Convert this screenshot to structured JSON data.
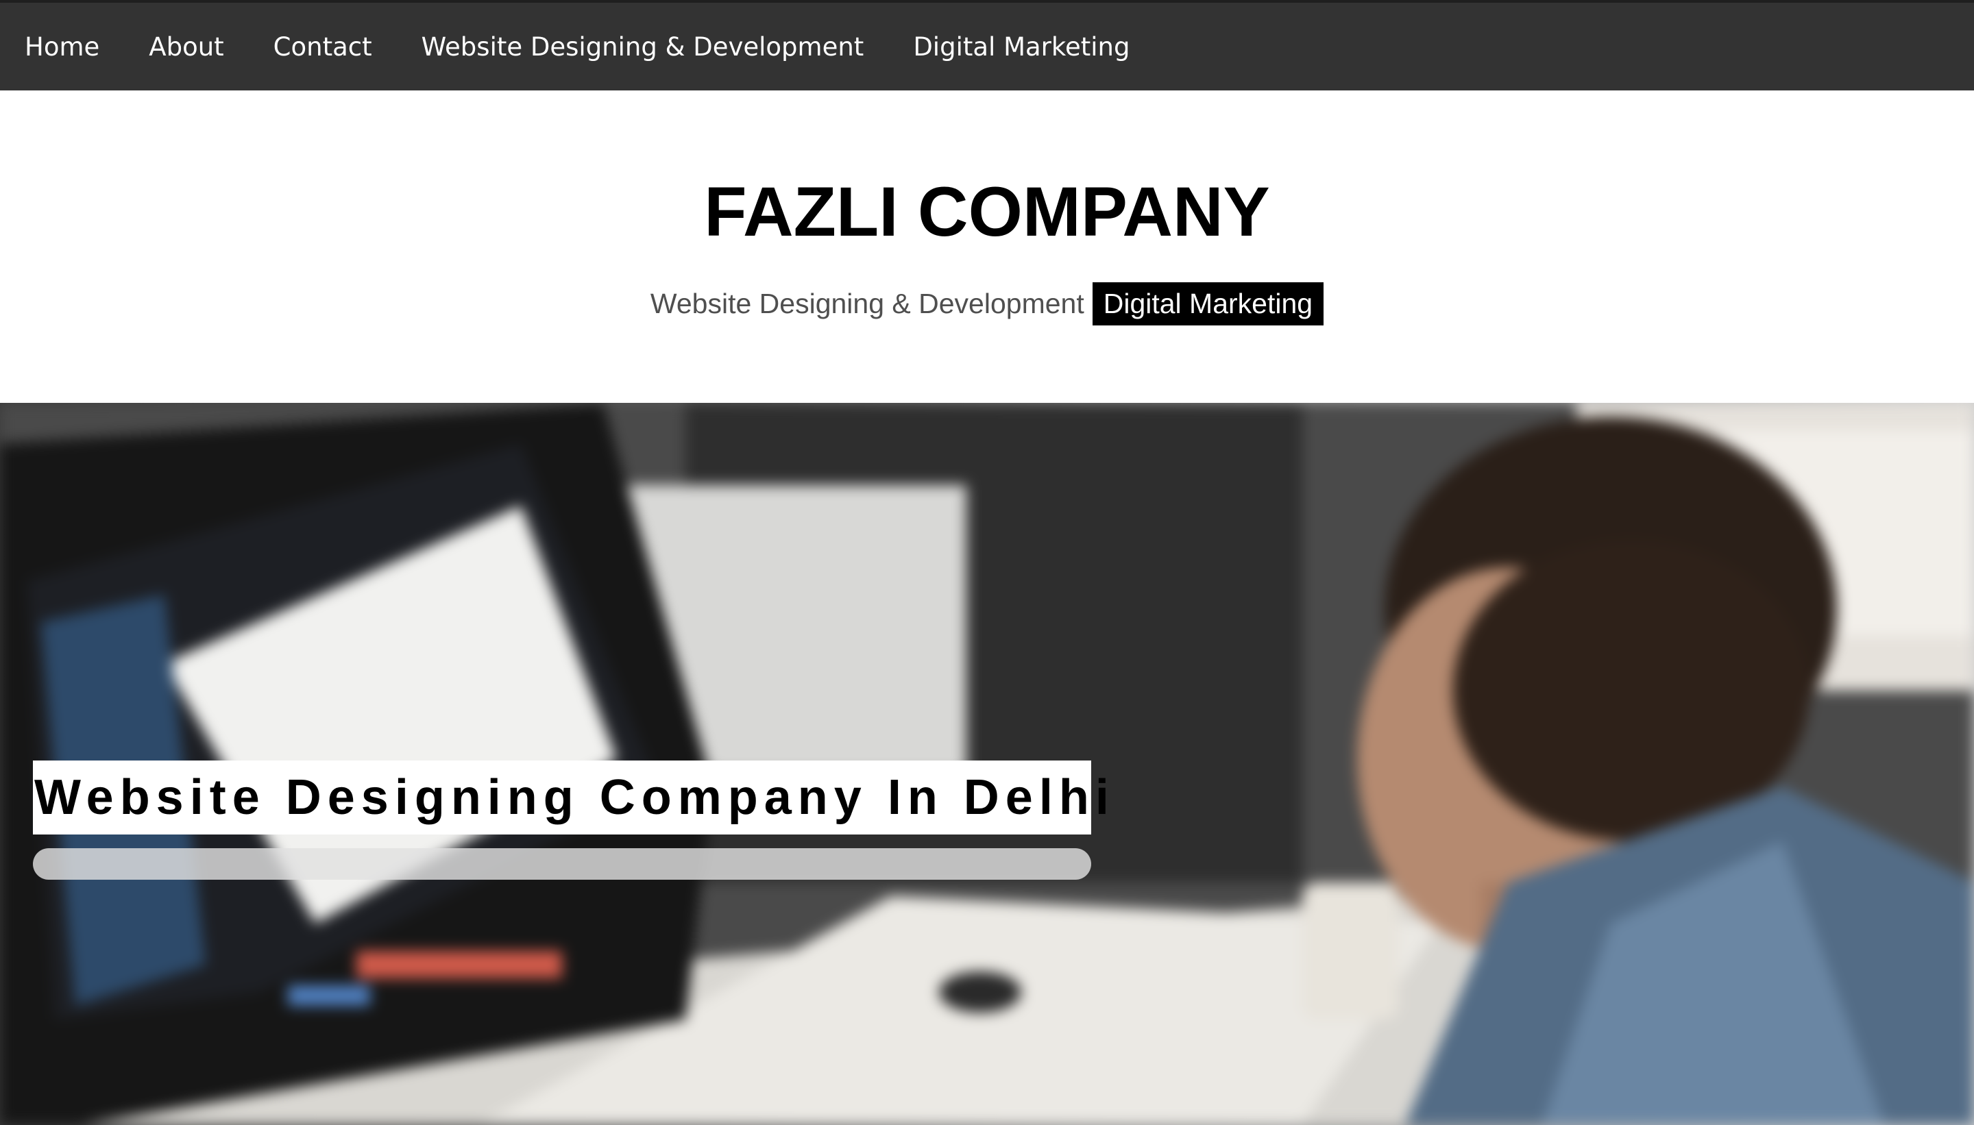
{
  "nav": {
    "items": [
      {
        "label": "Home"
      },
      {
        "label": "About"
      },
      {
        "label": "Contact"
      },
      {
        "label": "Website Designing & Development"
      },
      {
        "label": "Digital Marketing"
      }
    ]
  },
  "header": {
    "title": "FAZLI COMPANY",
    "tagline_link": "Website Designing & Development",
    "tagline_highlight": "Digital Marketing"
  },
  "hero": {
    "heading": "Website Designing Company In Delhi",
    "image_icon": "office-photo-image"
  },
  "colors": {
    "navbar_bg": "#333333",
    "nav_text": "#ffffff",
    "title_text": "#000000",
    "tagline_text": "#4f4f4f",
    "highlight_bg": "#000000",
    "highlight_text": "#ffffff"
  }
}
